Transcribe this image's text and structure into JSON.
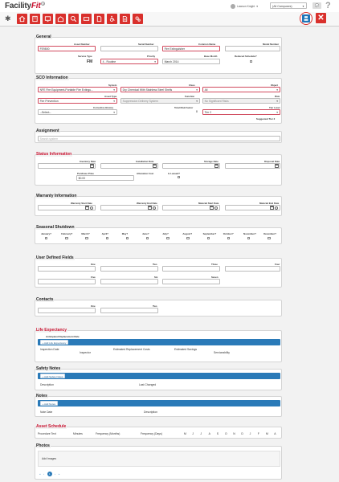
{
  "app": {
    "logo_main": "Facility",
    "logo_fit": "Fit",
    "logo_sup": "©",
    "user_name": "Lawson Knight",
    "campus": "(All Campuses)"
  },
  "colors": {
    "brand_red": "#d9302c",
    "link_blue": "#2a7ab8",
    "required_border": "#d14b5f"
  },
  "general": {
    "title": "General",
    "asset_number_label": "Asset Number",
    "asset_number": "FE9800",
    "serial_number_label": "Serial Number",
    "serial_number": "",
    "common_name_label": "Common Name",
    "common_name": "Fire Extinguisher",
    "model_number_label": "Model Number",
    "model_number": "",
    "service_type_label": "Service Type",
    "service_type": "FM",
    "priority_label": "Priority",
    "priority": "4 - Routine",
    "base_month_label": "Base Month",
    "base_month": "March 2014",
    "reduced_schedule_label": "Reduced Schedule?"
  },
  "sco": {
    "title": "SCO Information",
    "system_label": "System",
    "system": "NFE Fire Equipment-Portable Fire Extingu...",
    "class_label": "Class",
    "class": "Dry Chemical With Stainless Steel Shells",
    "object_label": "Object",
    "object": "All",
    "asset_type_label": "Asset Type",
    "asset_type": "Fire Prevention",
    "function_label": "Function",
    "function": "Suppression Delivery System",
    "risk_label": "Risk",
    "risk": "No Significant Risks",
    "corrective_history_label": "Corrective History",
    "corrective_history": "--Select--",
    "total_risk_factor_label": "Total Risk Factor",
    "total_risk_factor": "8",
    "tier_level_label": "Tier Level",
    "tier_level": "Tier 2",
    "suggested_tier": "Suggested Tier 2"
  },
  "assignment": {
    "title": "Assignment",
    "placeholder": "Search system"
  },
  "status": {
    "title": "Status Information",
    "inventory_date_label": "Inventory Date",
    "installation_date_label": "Installation Date",
    "storage_date_label": "Storage Date",
    "disposal_date_label": "Disposal Date",
    "purchase_price_label": "Purchase Price",
    "purchase_price": "$0.00",
    "allocation_cost_label": "Allocation Cost",
    "is_leased_label": "Is Leased?"
  },
  "warranty": {
    "title": "Warranty Information",
    "warranty_start_label": "Warranty Start Date",
    "warranty_end_label": "Warranty End Date",
    "material_start_label": "Material Start Date",
    "material_end_label": "Material End Date"
  },
  "seasonal": {
    "title": "Seasonal Shutdown",
    "months": [
      "January?",
      "February?",
      "March?",
      "April?",
      "May?",
      "June?",
      "July?",
      "August?",
      "September?",
      "October?",
      "November?",
      "December?"
    ]
  },
  "user_defined": {
    "title": "User Defined Fields",
    "labels": [
      "One",
      "Two",
      "Three",
      "Four",
      "Five",
      "Six",
      "Seven"
    ]
  },
  "contacts": {
    "title": "Contacts",
    "labels": [
      "One",
      "Two"
    ]
  },
  "life_expectancy": {
    "title": "Life Expectancy",
    "anticipated_label": "Anticipated Replacement Date",
    "add_button": "+ Add Life Expectancy",
    "columns": [
      "Inspection Date",
      "Inspector",
      "Estimated Replacement Costs",
      "Estimated Savings",
      "Serviceability"
    ]
  },
  "safety_notes": {
    "title": "Safety Notes",
    "add_button": "+ Add Safety Notes",
    "columns": [
      "Description",
      "Last Changed"
    ]
  },
  "notes": {
    "title": "Notes",
    "add_button": "+ Add Notes",
    "columns": [
      "Note Date",
      "Description"
    ]
  },
  "asset_schedule": {
    "title": "Asset Schedule",
    "columns": [
      "Procedure Text",
      "Minutes",
      "Frequency (Months)",
      "Frequency (Days)"
    ],
    "months": [
      "M",
      "J",
      "J",
      "A",
      "S",
      "O",
      "N",
      "D",
      "J",
      "F",
      "M",
      "A"
    ]
  },
  "photos": {
    "title": "Photos",
    "add_images": "Add Images",
    "pager": [
      "«",
      "‹",
      "1",
      "›",
      "»"
    ]
  }
}
